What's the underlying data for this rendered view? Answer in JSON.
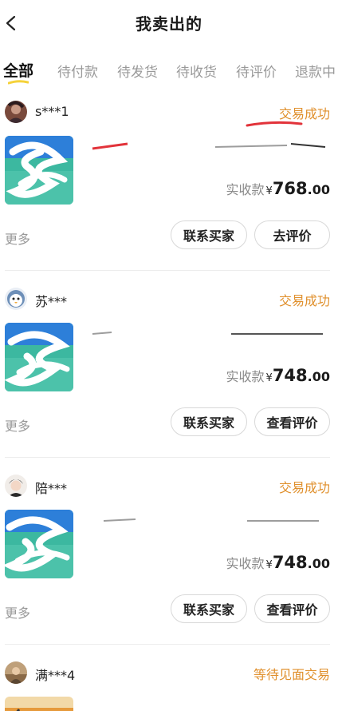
{
  "header": {
    "title": "我卖出的",
    "back_icon": "chevron-left-icon"
  },
  "tabs": [
    {
      "label": "全部",
      "active": true
    },
    {
      "label": "待付款",
      "active": false
    },
    {
      "label": "待发货",
      "active": false
    },
    {
      "label": "待收货",
      "active": false
    },
    {
      "label": "待评价",
      "active": false
    },
    {
      "label": "退款中",
      "active": false
    }
  ],
  "colors": {
    "accent_underline": "#f5d23a",
    "status": "#e0902d",
    "scribble_red": "#e2333a"
  },
  "orders": [
    {
      "buyer": "s***1",
      "status": "交易成功",
      "product_name": "",
      "price_label": "实收款",
      "currency": "¥",
      "price_int": "768",
      "price_dec": ".00",
      "more": "更多",
      "btn_contact": "联系买家",
      "btn_action": "去评价"
    },
    {
      "buyer": "苏***",
      "status": "交易成功",
      "product_name": "",
      "price_label": "实收款",
      "currency": "¥",
      "price_int": "748",
      "price_dec": ".00",
      "more": "更多",
      "btn_contact": "联系买家",
      "btn_action": "查看评价"
    },
    {
      "buyer": "陪***",
      "status": "交易成功",
      "product_name": "",
      "price_label": "实收款",
      "currency": "¥",
      "price_int": "748",
      "price_dec": ".00",
      "more": "更多",
      "btn_contact": "联系买家",
      "btn_action": "查看评价"
    },
    {
      "buyer": "满***4",
      "status": "等待见面交易"
    }
  ]
}
